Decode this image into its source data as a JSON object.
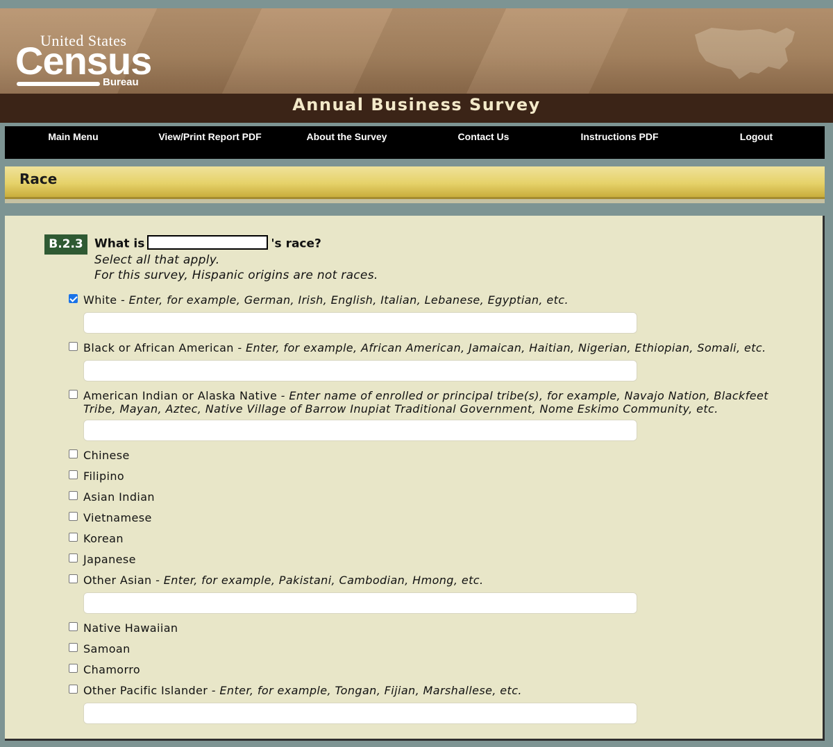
{
  "header": {
    "logo_line1": "United States",
    "logo_tm": "™",
    "logo_line2": "Census",
    "logo_line3": "Bureau",
    "survey_title": "Annual Business Survey"
  },
  "nav": {
    "items": [
      "Main Menu",
      "View/Print Report PDF",
      "About the Survey",
      "Contact Us",
      "Instructions PDF",
      "Logout"
    ]
  },
  "section": {
    "title": "Race"
  },
  "question": {
    "number": "B.2.3",
    "prefix": "What is",
    "suffix": "'s race?",
    "instruction1": "Select all that apply.",
    "instruction2": "For this survey, Hispanic origins are not races."
  },
  "options": [
    {
      "label": "White",
      "hint": " - Enter, for example, German, Irish, English, Italian, Lebanese, Egyptian, etc.",
      "checked": true,
      "field_value": ""
    },
    {
      "label": "Black or African American",
      "hint": " - Enter, for example, African American, Jamaican, Haitian, Nigerian, Ethiopian, Somali, etc.",
      "checked": false,
      "field_value": ""
    },
    {
      "label": "American Indian or Alaska Native",
      "hint": " - Enter name of enrolled or principal tribe(s), for example, Navajo Nation, Blackfeet Tribe, Mayan, Aztec, Native Village of Barrow Inupiat Traditional Government, Nome Eskimo Community, etc.",
      "checked": false,
      "field_value": ""
    },
    {
      "label": "Chinese",
      "checked": false
    },
    {
      "label": "Filipino",
      "checked": false
    },
    {
      "label": "Asian Indian",
      "checked": false
    },
    {
      "label": "Vietnamese",
      "checked": false
    },
    {
      "label": "Korean",
      "checked": false
    },
    {
      "label": "Japanese",
      "checked": false
    },
    {
      "label": "Other Asian",
      "hint": " - Enter, for example, Pakistani, Cambodian, Hmong, etc.",
      "checked": false,
      "field_value": ""
    },
    {
      "label": "Native Hawaiian",
      "checked": false
    },
    {
      "label": "Samoan",
      "checked": false
    },
    {
      "label": "Chamorro",
      "checked": false
    },
    {
      "label": "Other Pacific Islander",
      "hint": " - Enter, for example, Tongan, Fijian, Marshallese, etc.",
      "checked": false,
      "field_value": ""
    }
  ],
  "colors": {
    "title_bar": "#3b2417",
    "nav_bg": "#000000",
    "section_gold": "#e6d26a",
    "panel_bg": "#e8e6c8",
    "question_badge": "#2f5a33",
    "checkbox_checked": "#1a73e8"
  }
}
